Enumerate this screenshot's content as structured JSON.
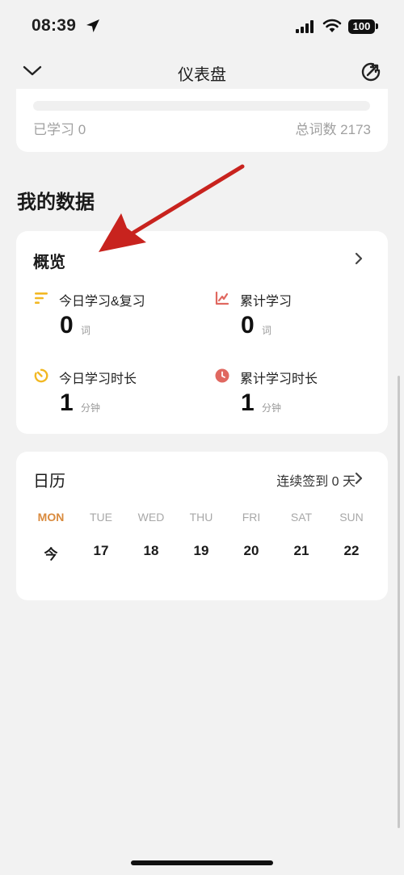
{
  "status_bar": {
    "time": "08:39",
    "battery": "100"
  },
  "nav": {
    "title": "仪表盘"
  },
  "progress": {
    "learned_label": "已学习 0",
    "total_label": "总词数 2173",
    "fraction": 0
  },
  "section": {
    "title": "我的数据"
  },
  "overview": {
    "title": "概览",
    "stats": [
      {
        "label": "今日学习&复习",
        "value": "0",
        "unit": "词",
        "icon": "bars-icon",
        "color": "#f2b824"
      },
      {
        "label": "累计学习",
        "value": "0",
        "unit": "词",
        "icon": "line-chart-icon",
        "color": "#e06860"
      },
      {
        "label": "今日学习时长",
        "value": "1",
        "unit": "分钟",
        "icon": "timer-icon",
        "color": "#f2b824"
      },
      {
        "label": "累计学习时长",
        "value": "1",
        "unit": "分钟",
        "icon": "clock-icon",
        "color": "#e06860"
      }
    ]
  },
  "calendar": {
    "title": "日历",
    "streak": "连续签到 0 天",
    "weekdays": [
      "MON",
      "TUE",
      "WED",
      "THU",
      "FRI",
      "SAT",
      "SUN"
    ],
    "dates": [
      "今",
      "17",
      "18",
      "19",
      "20",
      "21",
      "22"
    ]
  },
  "colors": {
    "accent_orange": "#d98a3d",
    "arrow_red": "#c8231e",
    "icon_yellow": "#f2b824",
    "icon_red": "#e06860"
  }
}
